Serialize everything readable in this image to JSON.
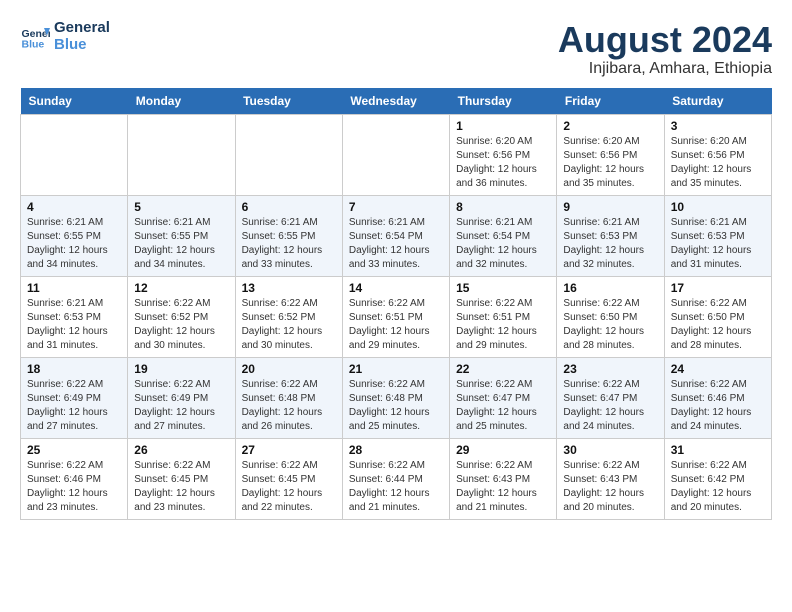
{
  "header": {
    "logo_line1": "General",
    "logo_line2": "Blue",
    "month_year": "August 2024",
    "location": "Injibara, Amhara, Ethiopia"
  },
  "weekdays": [
    "Sunday",
    "Monday",
    "Tuesday",
    "Wednesday",
    "Thursday",
    "Friday",
    "Saturday"
  ],
  "weeks": [
    [
      {
        "day": "",
        "info": ""
      },
      {
        "day": "",
        "info": ""
      },
      {
        "day": "",
        "info": ""
      },
      {
        "day": "",
        "info": ""
      },
      {
        "day": "1",
        "info": "Sunrise: 6:20 AM\nSunset: 6:56 PM\nDaylight: 12 hours\nand 36 minutes."
      },
      {
        "day": "2",
        "info": "Sunrise: 6:20 AM\nSunset: 6:56 PM\nDaylight: 12 hours\nand 35 minutes."
      },
      {
        "day": "3",
        "info": "Sunrise: 6:20 AM\nSunset: 6:56 PM\nDaylight: 12 hours\nand 35 minutes."
      }
    ],
    [
      {
        "day": "4",
        "info": "Sunrise: 6:21 AM\nSunset: 6:55 PM\nDaylight: 12 hours\nand 34 minutes."
      },
      {
        "day": "5",
        "info": "Sunrise: 6:21 AM\nSunset: 6:55 PM\nDaylight: 12 hours\nand 34 minutes."
      },
      {
        "day": "6",
        "info": "Sunrise: 6:21 AM\nSunset: 6:55 PM\nDaylight: 12 hours\nand 33 minutes."
      },
      {
        "day": "7",
        "info": "Sunrise: 6:21 AM\nSunset: 6:54 PM\nDaylight: 12 hours\nand 33 minutes."
      },
      {
        "day": "8",
        "info": "Sunrise: 6:21 AM\nSunset: 6:54 PM\nDaylight: 12 hours\nand 32 minutes."
      },
      {
        "day": "9",
        "info": "Sunrise: 6:21 AM\nSunset: 6:53 PM\nDaylight: 12 hours\nand 32 minutes."
      },
      {
        "day": "10",
        "info": "Sunrise: 6:21 AM\nSunset: 6:53 PM\nDaylight: 12 hours\nand 31 minutes."
      }
    ],
    [
      {
        "day": "11",
        "info": "Sunrise: 6:21 AM\nSunset: 6:53 PM\nDaylight: 12 hours\nand 31 minutes."
      },
      {
        "day": "12",
        "info": "Sunrise: 6:22 AM\nSunset: 6:52 PM\nDaylight: 12 hours\nand 30 minutes."
      },
      {
        "day": "13",
        "info": "Sunrise: 6:22 AM\nSunset: 6:52 PM\nDaylight: 12 hours\nand 30 minutes."
      },
      {
        "day": "14",
        "info": "Sunrise: 6:22 AM\nSunset: 6:51 PM\nDaylight: 12 hours\nand 29 minutes."
      },
      {
        "day": "15",
        "info": "Sunrise: 6:22 AM\nSunset: 6:51 PM\nDaylight: 12 hours\nand 29 minutes."
      },
      {
        "day": "16",
        "info": "Sunrise: 6:22 AM\nSunset: 6:50 PM\nDaylight: 12 hours\nand 28 minutes."
      },
      {
        "day": "17",
        "info": "Sunrise: 6:22 AM\nSunset: 6:50 PM\nDaylight: 12 hours\nand 28 minutes."
      }
    ],
    [
      {
        "day": "18",
        "info": "Sunrise: 6:22 AM\nSunset: 6:49 PM\nDaylight: 12 hours\nand 27 minutes."
      },
      {
        "day": "19",
        "info": "Sunrise: 6:22 AM\nSunset: 6:49 PM\nDaylight: 12 hours\nand 27 minutes."
      },
      {
        "day": "20",
        "info": "Sunrise: 6:22 AM\nSunset: 6:48 PM\nDaylight: 12 hours\nand 26 minutes."
      },
      {
        "day": "21",
        "info": "Sunrise: 6:22 AM\nSunset: 6:48 PM\nDaylight: 12 hours\nand 25 minutes."
      },
      {
        "day": "22",
        "info": "Sunrise: 6:22 AM\nSunset: 6:47 PM\nDaylight: 12 hours\nand 25 minutes."
      },
      {
        "day": "23",
        "info": "Sunrise: 6:22 AM\nSunset: 6:47 PM\nDaylight: 12 hours\nand 24 minutes."
      },
      {
        "day": "24",
        "info": "Sunrise: 6:22 AM\nSunset: 6:46 PM\nDaylight: 12 hours\nand 24 minutes."
      }
    ],
    [
      {
        "day": "25",
        "info": "Sunrise: 6:22 AM\nSunset: 6:46 PM\nDaylight: 12 hours\nand 23 minutes."
      },
      {
        "day": "26",
        "info": "Sunrise: 6:22 AM\nSunset: 6:45 PM\nDaylight: 12 hours\nand 23 minutes."
      },
      {
        "day": "27",
        "info": "Sunrise: 6:22 AM\nSunset: 6:45 PM\nDaylight: 12 hours\nand 22 minutes."
      },
      {
        "day": "28",
        "info": "Sunrise: 6:22 AM\nSunset: 6:44 PM\nDaylight: 12 hours\nand 21 minutes."
      },
      {
        "day": "29",
        "info": "Sunrise: 6:22 AM\nSunset: 6:43 PM\nDaylight: 12 hours\nand 21 minutes."
      },
      {
        "day": "30",
        "info": "Sunrise: 6:22 AM\nSunset: 6:43 PM\nDaylight: 12 hours\nand 20 minutes."
      },
      {
        "day": "31",
        "info": "Sunrise: 6:22 AM\nSunset: 6:42 PM\nDaylight: 12 hours\nand 20 minutes."
      }
    ]
  ]
}
